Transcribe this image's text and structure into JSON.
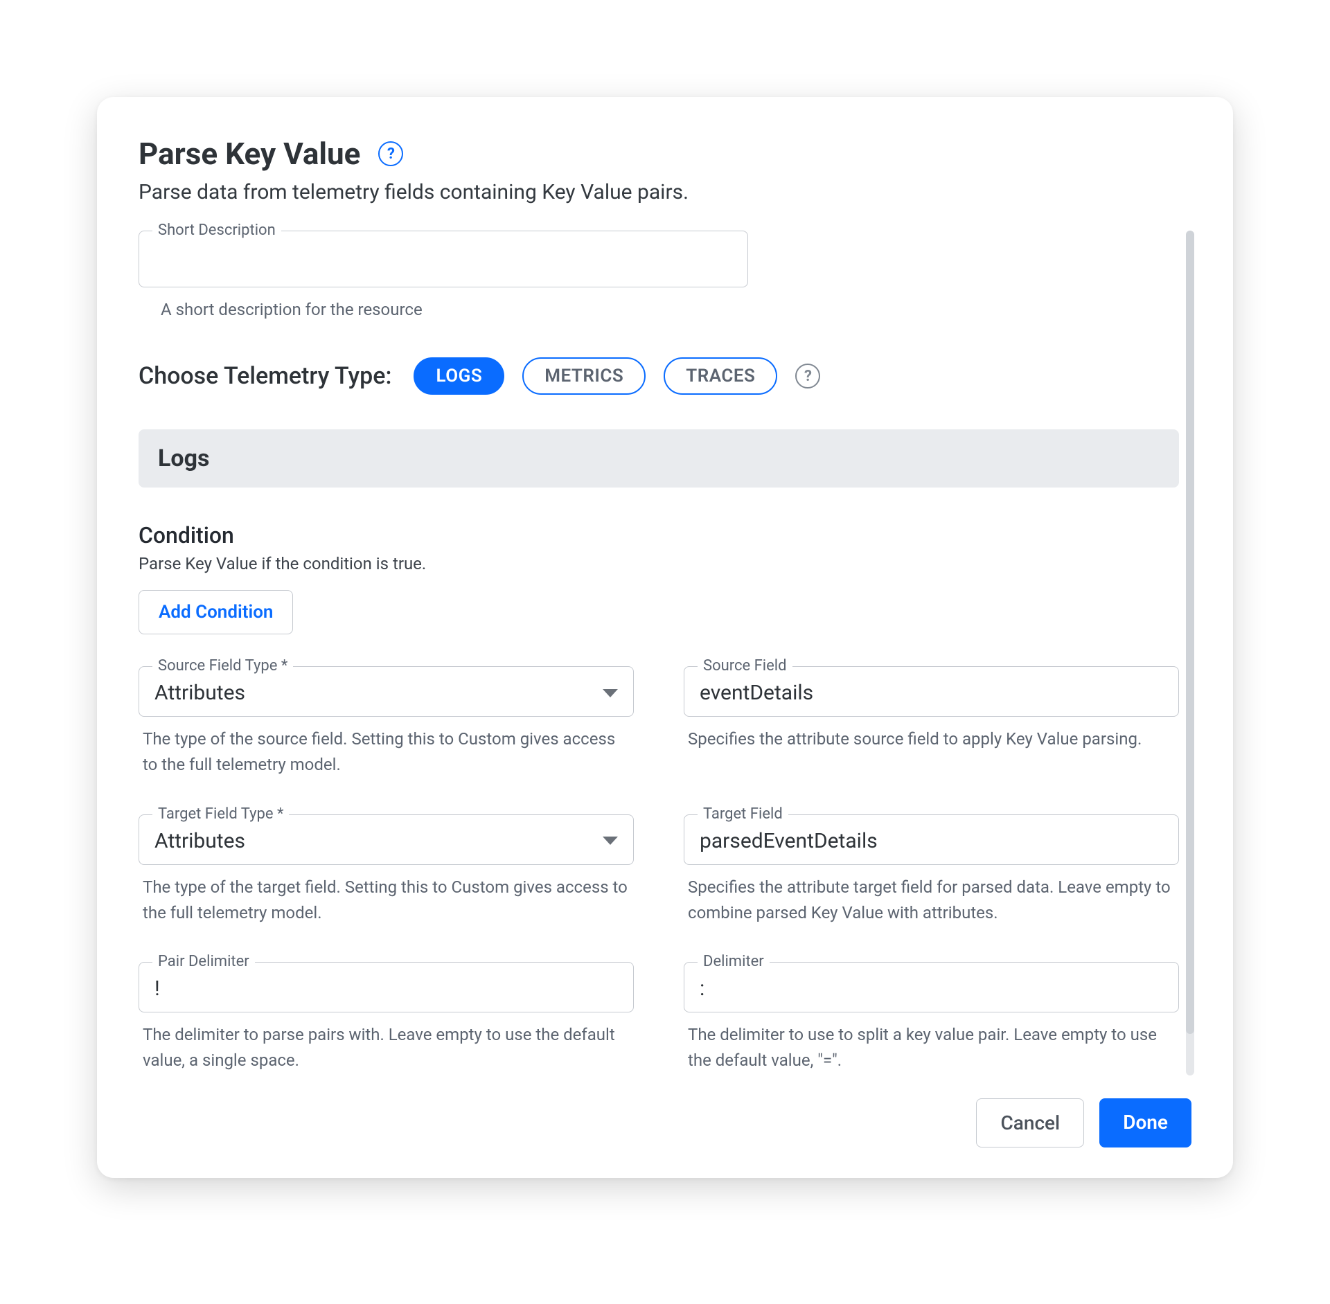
{
  "header": {
    "title": "Parse Key Value",
    "subtitle": "Parse data from telemetry fields containing Key Value pairs.",
    "help_glyph": "?"
  },
  "short_description": {
    "label": "Short Description",
    "value": "",
    "help": "A short description for the resource"
  },
  "telemetry": {
    "label": "Choose Telemetry Type:",
    "options": [
      "LOGS",
      "METRICS",
      "TRACES"
    ],
    "help_glyph": "?"
  },
  "section": {
    "title": "Logs"
  },
  "condition": {
    "title": "Condition",
    "subtitle": "Parse Key Value if the condition is true.",
    "add_button": "Add Condition"
  },
  "fields": {
    "source_field_type": {
      "label": "Source Field Type *",
      "value": "Attributes",
      "help": "The type of the source field. Setting this to Custom gives access to the full telemetry model."
    },
    "source_field": {
      "label": "Source Field",
      "value": "eventDetails",
      "help": "Specifies the attribute source field to apply Key Value parsing."
    },
    "target_field_type": {
      "label": "Target Field Type *",
      "value": "Attributes",
      "help": "The type of the target field. Setting this to Custom gives access to the full telemetry model."
    },
    "target_field": {
      "label": "Target Field",
      "value": "parsedEventDetails",
      "help": "Specifies the attribute target field for parsed data. Leave empty to combine parsed Key Value with attributes."
    },
    "pair_delimiter": {
      "label": "Pair Delimiter",
      "value": "!",
      "help": "The delimiter to parse pairs with. Leave empty to use the default value, a single space."
    },
    "delimiter": {
      "label": "Delimiter",
      "value": ":",
      "help": "The delimiter to use to split a key value pair. Leave empty to use the default value, \"=\"."
    }
  },
  "footer": {
    "cancel": "Cancel",
    "done": "Done"
  }
}
